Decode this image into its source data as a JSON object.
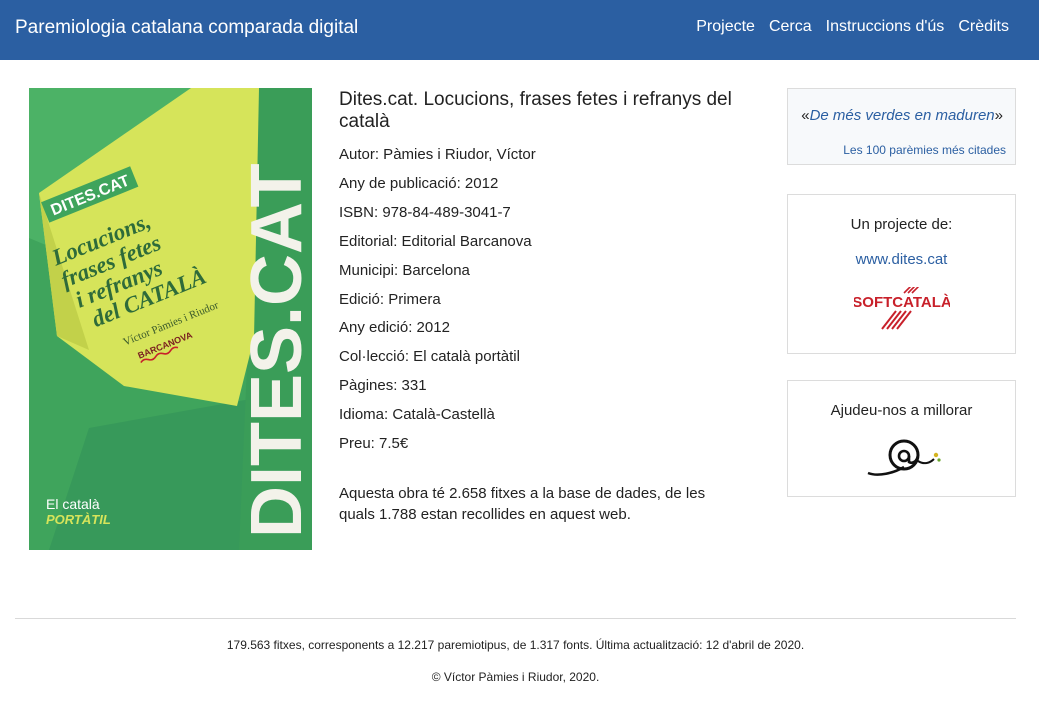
{
  "header": {
    "brand": "Paremiologia catalana comparada digital",
    "nav": [
      "Projecte",
      "Cerca",
      "Instruccions d'ús",
      "Crèdits"
    ]
  },
  "cover": {
    "spine_text": "DITES.CAT",
    "badge": "DITES.CAT",
    "title_lines": [
      "Locucions,",
      "frases fetes",
      "i refranys",
      "del CATALÀ"
    ],
    "author": "Víctor Pàmies i Riudor",
    "publisher": "BARCANOVA",
    "collection_lines": [
      "El català",
      "PORTÀTIL"
    ]
  },
  "book": {
    "title": "Dites.cat. Locucions, frases fetes i refranys del català",
    "fields": [
      "Autor: Pàmies i Riudor, Víctor",
      "Any de publicació: 2012",
      "ISBN: 978-84-489-3041-7",
      "Editorial: Editorial Barcanova",
      "Municipi: Barcelona",
      "Edició: Primera",
      "Any edició: 2012",
      "Col·lecció: El català portàtil",
      "Pàgines: 331",
      "Idioma: Català-Castellà",
      "Preu: 7.5€"
    ],
    "summary": "Aquesta obra té 2.658 fitxes a la base de dades, de les quals 1.788 estan recollides en aquest web."
  },
  "sidebar": {
    "proverb": {
      "open_quote": "«",
      "text": "De més verdes en maduren",
      "close_quote": "»",
      "link": "Les 100 parèmies més citades"
    },
    "project": {
      "heading": "Un projecte de:",
      "link": "www.dites.cat",
      "logo_text": "SOFTCATALÀ"
    },
    "help": {
      "heading": "Ajudeu-nos a millorar"
    }
  },
  "footer": {
    "stats": "179.563 fitxes, corresponents a 12.217 paremiotipus, de 1.317 fonts. Última actualització: 12 d'abril de 2020.",
    "copyright": "© Víctor Pàmies i Riudor, 2020."
  },
  "colors": {
    "header_bg": "#2b5fa2",
    "link": "#2b5fa2",
    "cover_green": "#3fa45c",
    "cover_yellow": "#d6e45a",
    "logo_red": "#c8202a"
  }
}
